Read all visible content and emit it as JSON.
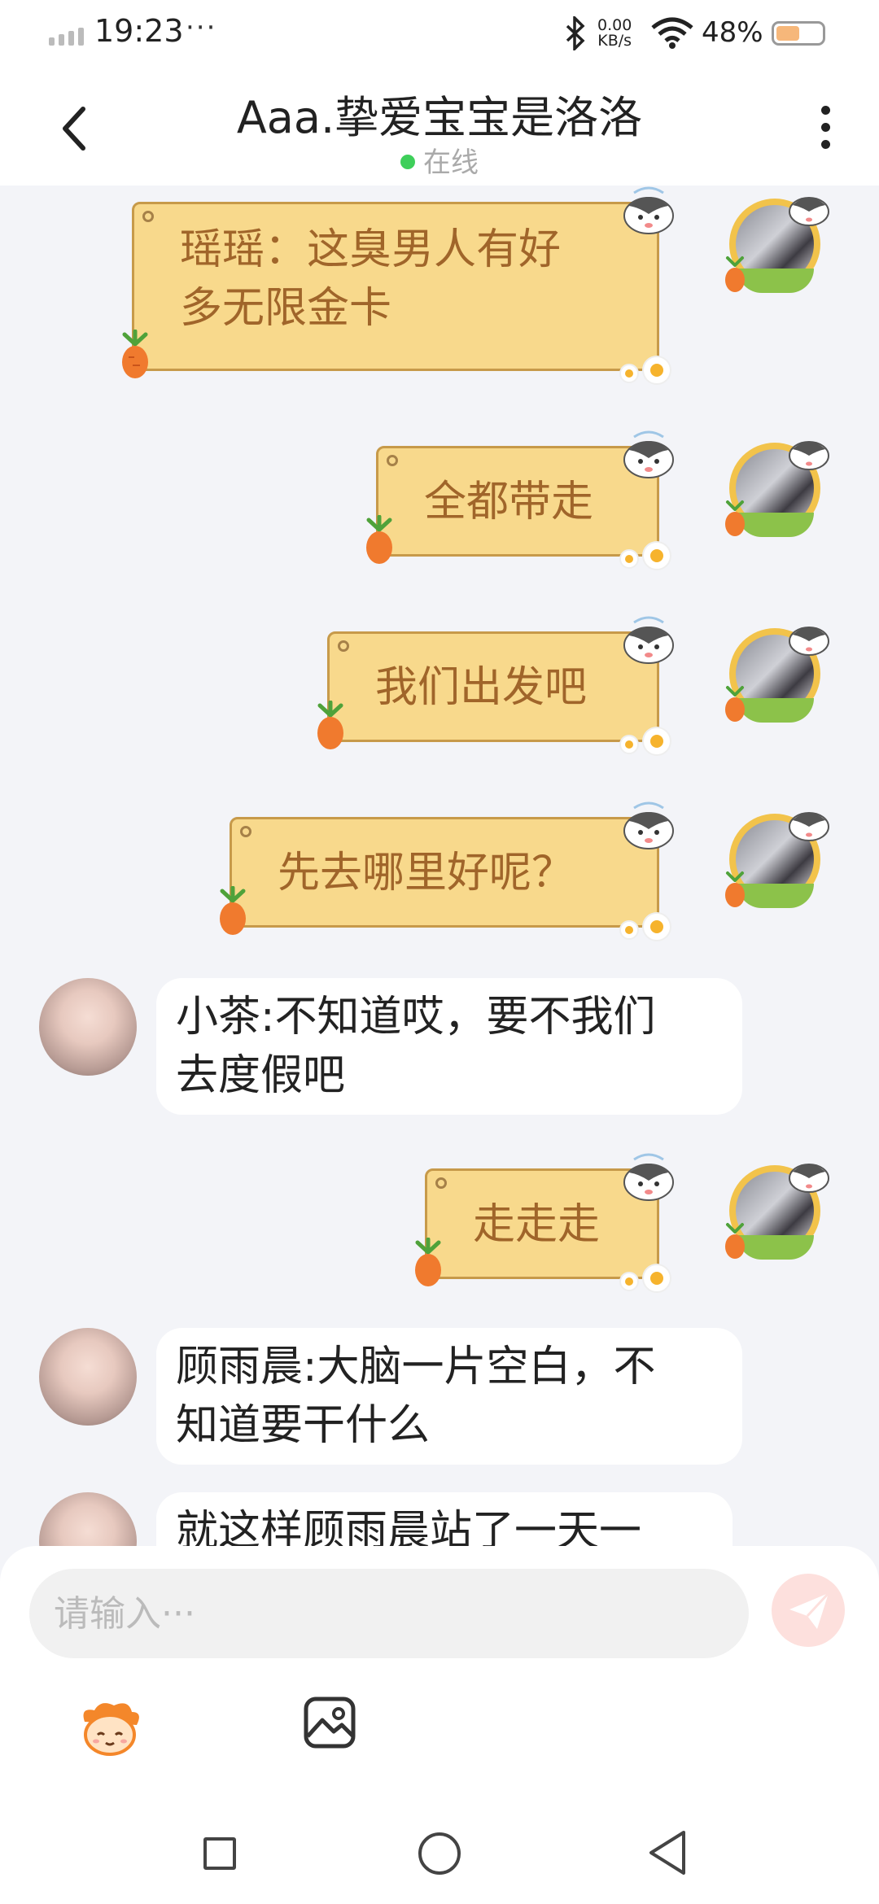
{
  "status_bar": {
    "time": "19:23",
    "dots": "···",
    "net_speed_value": "0.00",
    "net_speed_unit": "KB/s",
    "battery": "48%"
  },
  "header": {
    "title": "Aaa.挚爱宝宝是洛洛",
    "status": "在线",
    "status_color": "#3ecf5a"
  },
  "messages": [
    {
      "side": "right",
      "line1": "瑶瑶：这臭男人有好",
      "line2": "多无限金卡"
    },
    {
      "side": "right",
      "line1": "全都带走"
    },
    {
      "side": "right",
      "line1": "我们出发吧"
    },
    {
      "side": "right",
      "line1": "先去哪里好呢？"
    },
    {
      "side": "left",
      "line1": "小茶:不知道哎，要不我们",
      "line2": "去度假吧"
    },
    {
      "side": "right",
      "line1": "走走走"
    },
    {
      "side": "left",
      "line1": "顾雨晨:大脑一片空白，不",
      "line2": "知道要干什么"
    },
    {
      "side": "left",
      "line1": "就这样顾雨晨站了一天一"
    }
  ],
  "input": {
    "placeholder": "请输入···",
    "value": ""
  },
  "colors": {
    "bubble_fill": "#f8d98c",
    "bubble_border": "#c79a4a",
    "bubble_text": "#a0652a",
    "chat_background": "#f3f4f8",
    "send_button": "#fde0dd"
  },
  "icons": {
    "back": "chevron-left-icon",
    "more": "more-vertical-icon",
    "send": "paper-plane-icon",
    "emoji": "emoji-sticker-icon",
    "image": "image-icon",
    "nav_recent": "square-icon",
    "nav_home": "circle-icon",
    "nav_back": "triangle-back-icon"
  }
}
